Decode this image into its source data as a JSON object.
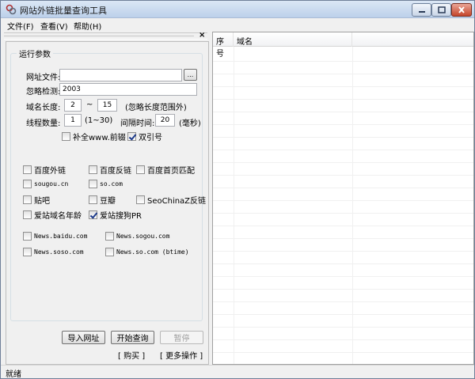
{
  "window": {
    "title": "网站外链批量查询工具"
  },
  "menu": [
    {
      "label": "文件(F)"
    },
    {
      "label": "查看(V)"
    },
    {
      "label": "帮助(H)"
    }
  ],
  "params": {
    "group_label": "运行参数",
    "url_file_label": "网址文件:",
    "url_file_value": "",
    "browse_label": "...",
    "ignore_label": "忽略检测:",
    "ignore_value": "2003",
    "domain_len_label": "域名长度:",
    "domain_len_min": "2",
    "tilde": "~",
    "domain_len_max": "15",
    "domain_len_note": "(忽略长度范围外)",
    "threads_label": "线程数量:",
    "threads_value": "1",
    "threads_range": "(1~30)",
    "interval_label": "间隔时间:",
    "interval_value": "20",
    "interval_unit": "(毫秒)",
    "complete_www_label": "补全www.前辍",
    "complete_www_checked": false,
    "double_quote_label": "双引号",
    "double_quote_checked": true
  },
  "checks_row1": [
    {
      "label": "百度外链",
      "checked": false
    },
    {
      "label": "百度反链",
      "checked": false
    },
    {
      "label": "百度首页匹配",
      "checked": false
    }
  ],
  "checks_row2": [
    {
      "label": "sougou.cn",
      "checked": false
    },
    {
      "label": "so.com",
      "checked": false
    }
  ],
  "checks_row3": [
    {
      "label": "贴吧",
      "checked": false
    },
    {
      "label": "豆瓣",
      "checked": false
    },
    {
      "label": "SeoChinaZ反链",
      "checked": false
    }
  ],
  "checks_row4": [
    {
      "label": "爱站域名年龄",
      "checked": false
    },
    {
      "label": "爱站搜狗PR",
      "checked": true
    }
  ],
  "news_checks": [
    {
      "label": "News.baidu.com",
      "checked": false
    },
    {
      "label": "News.sogou.com",
      "checked": false
    },
    {
      "label": "News.soso.com",
      "checked": false
    },
    {
      "label": "News.so.com (btime)",
      "checked": false
    }
  ],
  "actions": {
    "import_label": "导入网址",
    "start_label": "开始查询",
    "pause_label": "暂停",
    "buy_label": "[ 购买 ]",
    "more_label": "[ 更多操作 ]"
  },
  "results": {
    "columns": [
      "序号",
      "域名"
    ]
  },
  "status": {
    "text": "就绪"
  }
}
